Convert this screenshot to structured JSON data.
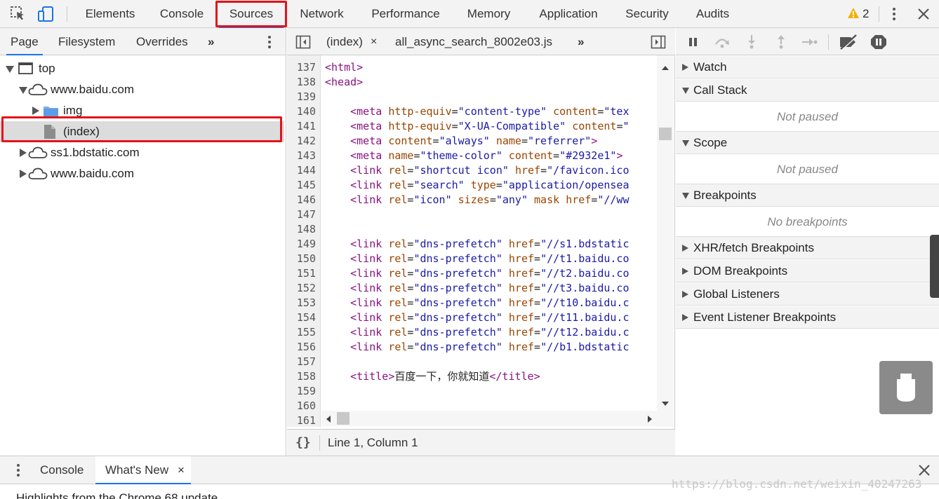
{
  "toolbar": {
    "tabs": [
      "Elements",
      "Console",
      "Sources",
      "Network",
      "Performance",
      "Memory",
      "Application",
      "Security",
      "Audits"
    ],
    "active_tab": "Sources",
    "warning_count": "2",
    "icons": [
      "inspect-element-icon",
      "device-toolbar-icon",
      "warning-icon",
      "kebab-menu-icon",
      "close-icon"
    ]
  },
  "navigator": {
    "tabs": [
      "Page",
      "Filesystem",
      "Overrides"
    ],
    "more": "»",
    "tree": [
      {
        "label": "top",
        "icon": "frame-icon",
        "expanded": true
      },
      {
        "label": "www.baidu.com",
        "icon": "cloud-icon",
        "expanded": true
      },
      {
        "label": "img",
        "icon": "folder-icon",
        "expanded": false
      },
      {
        "label": "(index)",
        "icon": "file-icon",
        "selected": true
      },
      {
        "label": "ss1.bdstatic.com",
        "icon": "cloud-icon",
        "expanded": false
      },
      {
        "label": "www.baidu.com",
        "icon": "cloud-icon",
        "expanded": false
      }
    ]
  },
  "editor": {
    "tabs": [
      "(index)",
      "all_async_search_8002e03.js"
    ],
    "close_glyph": "×",
    "more": "»",
    "line_numbers": [
      "137",
      "138",
      "139",
      "140",
      "141",
      "142",
      "143",
      "144",
      "145",
      "146",
      "147",
      "148",
      "149",
      "150",
      "151",
      "152",
      "153",
      "154",
      "155",
      "156",
      "157",
      "158",
      "159",
      "160",
      "161"
    ],
    "code": [
      "<html>",
      "<head>",
      "",
      "    <meta http-equiv=\"content-type\" content=\"tex",
      "    <meta http-equiv=\"X-UA-Compatible\" content=\"",
      "    <meta content=\"always\" name=\"referrer\">",
      "    <meta name=\"theme-color\" content=\"#2932e1\">",
      "    <link rel=\"shortcut icon\" href=\"/favicon.ico",
      "    <link rel=\"search\" type=\"application/opensea",
      "    <link rel=\"icon\" sizes=\"any\" mask href=\"//ww",
      "",
      "",
      "    <link rel=\"dns-prefetch\" href=\"//s1.bdstatic",
      "    <link rel=\"dns-prefetch\" href=\"//t1.baidu.co",
      "    <link rel=\"dns-prefetch\" href=\"//t2.baidu.co",
      "    <link rel=\"dns-prefetch\" href=\"//t3.baidu.co",
      "    <link rel=\"dns-prefetch\" href=\"//t10.baidu.c",
      "    <link rel=\"dns-prefetch\" href=\"//t11.baidu.c",
      "    <link rel=\"dns-prefetch\" href=\"//t12.baidu.c",
      "    <link rel=\"dns-prefetch\" href=\"//b1.bdstatic",
      "",
      "    <title>百度一下，你就知道</title>",
      "",
      "",
      ""
    ],
    "status": "Line 1, Column 1",
    "pretty_print": "{}"
  },
  "debugger": {
    "toolbar_icons": [
      "pause-icon",
      "step-over-icon",
      "step-into-icon",
      "step-out-icon",
      "step-icon",
      "deactivate-breakpoints-icon",
      "pause-on-exceptions-icon"
    ],
    "sections": [
      {
        "label": "Watch",
        "expanded": false
      },
      {
        "label": "Call Stack",
        "expanded": true,
        "body": "Not paused"
      },
      {
        "label": "Scope",
        "expanded": true,
        "body": "Not paused"
      },
      {
        "label": "Breakpoints",
        "expanded": true,
        "body": "No breakpoints"
      },
      {
        "label": "XHR/fetch Breakpoints",
        "expanded": false
      },
      {
        "label": "DOM Breakpoints",
        "expanded": false
      },
      {
        "label": "Global Listeners",
        "expanded": false
      },
      {
        "label": "Event Listener Breakpoints",
        "expanded": false
      }
    ]
  },
  "drawer": {
    "tabs": [
      "Console",
      "What's New"
    ],
    "active_tab": "What's New",
    "close_glyph": "×",
    "content": "Highlights from the Chrome 68 update"
  },
  "watermark": "https://blog.csdn.net/weixin_40247263",
  "colors": {
    "highlight_box": "#e3131a",
    "active_tab_underline": "#1a73e8",
    "code_tag": "#881280",
    "code_attr": "#994500",
    "code_value": "#1a1aa6"
  }
}
